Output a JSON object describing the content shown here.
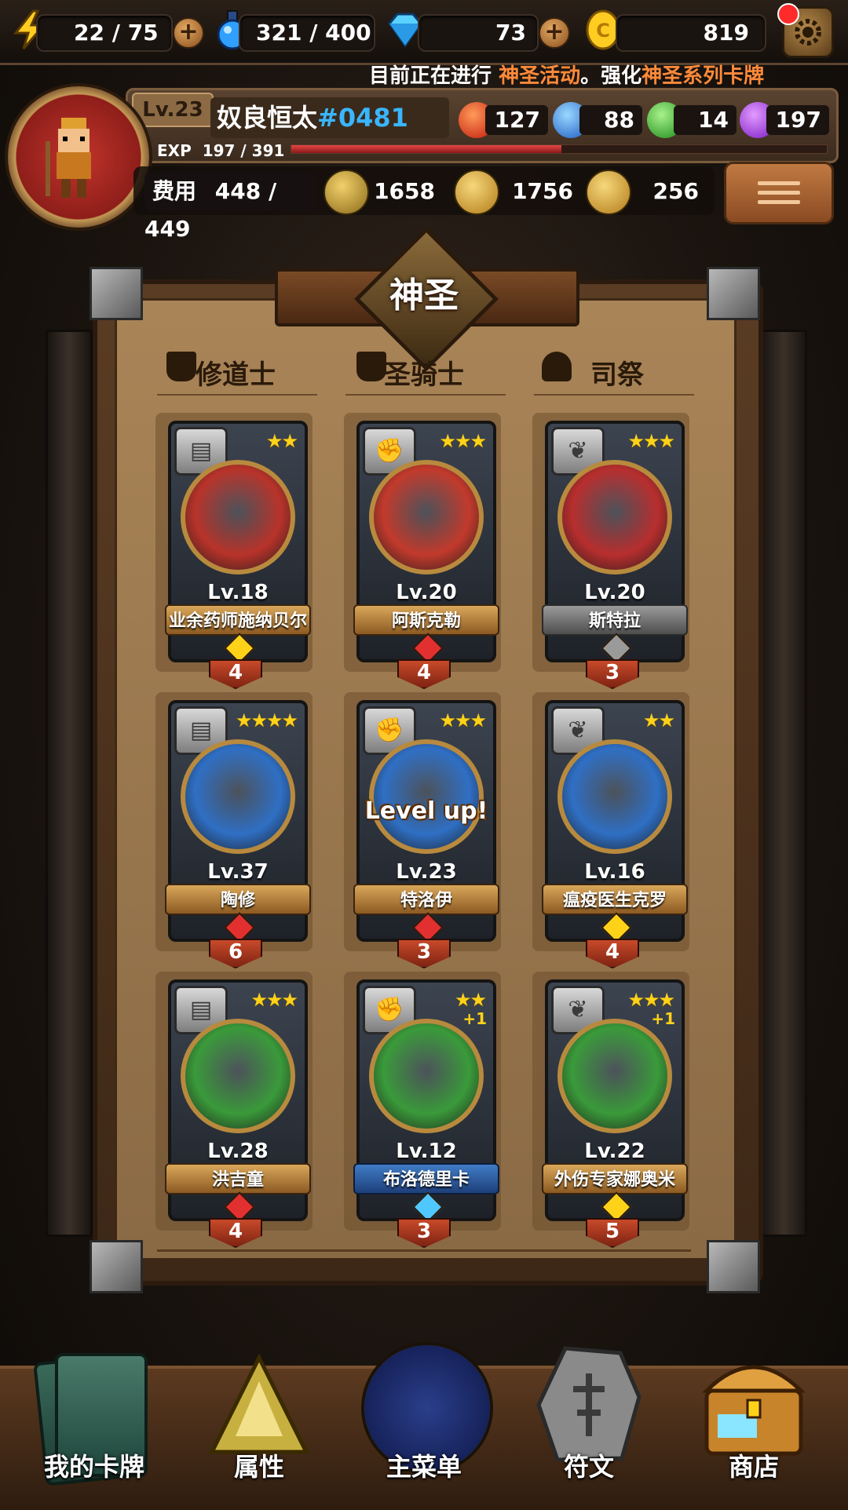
{
  "resources": {
    "energy": "22 / 75",
    "potion": "321 / 400",
    "gems": "73",
    "gold": "819"
  },
  "ticker": {
    "prefix": "目前正在进行",
    "event": "神圣活动",
    "middle": "。强化",
    "series": "神圣系列卡牌"
  },
  "player": {
    "level": "Lv.23",
    "name": "奴良恒太",
    "tag": "#0481",
    "exp_label": "EXP",
    "exp_value": "197 / 391",
    "exp_fraction": 0.504,
    "elements": {
      "fire": "127",
      "water": "88",
      "nature": "14",
      "dark": "197"
    },
    "stats": {
      "cost_label": "费用",
      "cost": "448 / 449",
      "attack": "1658",
      "hp": "1756",
      "heal": "256"
    }
  },
  "board": {
    "title": "神圣",
    "columns": [
      "修道士",
      "圣骑士",
      "司祭"
    ],
    "cards": [
      {
        "name": "业余药师施纳贝尔",
        "level": "Lv.18",
        "stars": "★★",
        "cost": "4",
        "plate": "gold",
        "portrait": "#b8332a",
        "gem": "#ffd21a",
        "klass": "book",
        "extra": "",
        "badge": ""
      },
      {
        "name": "阿斯克勒",
        "level": "Lv.20",
        "stars": "★★★",
        "cost": "4",
        "plate": "gold",
        "portrait": "#c23a2c",
        "gem": "#e23030",
        "klass": "fist",
        "extra": "",
        "badge": ""
      },
      {
        "name": "斯特拉",
        "level": "Lv.20",
        "stars": "★★★",
        "cost": "3",
        "plate": "silver",
        "portrait": "#b82e2e",
        "gem": "#9a9a9a",
        "klass": "wing",
        "extra": "",
        "badge": ""
      },
      {
        "name": "陶修",
        "level": "Lv.37",
        "stars": "★★★★",
        "cost": "6",
        "plate": "gold",
        "portrait": "#2f6fc4",
        "gem": "#e23030",
        "klass": "book",
        "extra": "",
        "badge": ""
      },
      {
        "name": "特洛伊",
        "level": "Lv.23",
        "stars": "★★★",
        "cost": "3",
        "plate": "gold",
        "portrait": "#2f6fc4",
        "gem": "#e23030",
        "klass": "fist",
        "extra": "",
        "badge": "Level up!"
      },
      {
        "name": "瘟疫医生克罗",
        "level": "Lv.16",
        "stars": "★★",
        "cost": "4",
        "plate": "gold",
        "portrait": "#2f6fc4",
        "gem": "#ffd21a",
        "klass": "wing",
        "extra": "",
        "badge": ""
      },
      {
        "name": "洪吉童",
        "level": "Lv.28",
        "stars": "★★★",
        "cost": "4",
        "plate": "gold",
        "portrait": "#3a9a3a",
        "gem": "#e23030",
        "klass": "book",
        "extra": "",
        "badge": ""
      },
      {
        "name": "布洛德里卡",
        "level": "Lv.12",
        "stars": "★★",
        "cost": "3",
        "plate": "blue",
        "portrait": "#3a9a3a",
        "gem": "#4fc8ff",
        "klass": "fist",
        "extra": "+1",
        "badge": ""
      },
      {
        "name": "外伤专家娜奥米",
        "level": "Lv.22",
        "stars": "★★★",
        "cost": "5",
        "plate": "gold",
        "portrait": "#3a9a3a",
        "gem": "#ffd21a",
        "klass": "wing",
        "extra": "+1",
        "badge": ""
      }
    ]
  },
  "nav": {
    "cards": "我的卡牌",
    "attributes": "属性",
    "main_menu": "主菜单",
    "runes": "符文",
    "shop": "商店"
  },
  "colors": {
    "accent": "#ff8a3a",
    "tag_blue": "#39b6ff",
    "star_gold": "#ffd21a",
    "cost_red": "#c84a2a"
  }
}
